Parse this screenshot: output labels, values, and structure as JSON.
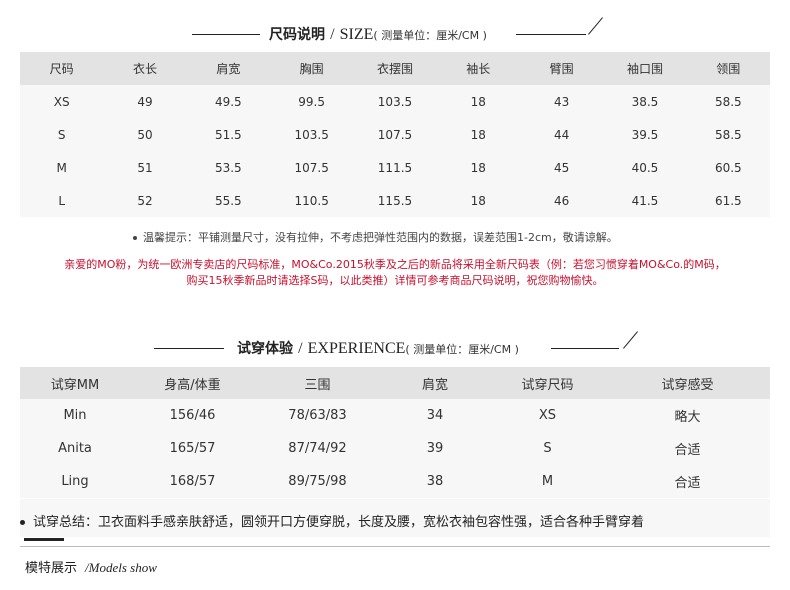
{
  "size": {
    "title_cn": "尺码说明",
    "title_sep": "/",
    "title_en": "SIZE",
    "unit": "( 测量单位：厘米/CM )",
    "headers": [
      "尺码",
      "衣长",
      "肩宽",
      "胸围",
      "衣摆围",
      "袖长",
      "臂围",
      "袖口围",
      "领围"
    ],
    "rows": [
      [
        "XS",
        "49",
        "49.5",
        "99.5",
        "103.5",
        "18",
        "43",
        "38.5",
        "58.5"
      ],
      [
        "S",
        "50",
        "51.5",
        "103.5",
        "107.5",
        "18",
        "44",
        "39.5",
        "58.5"
      ],
      [
        "M",
        "51",
        "53.5",
        "107.5",
        "111.5",
        "18",
        "45",
        "40.5",
        "60.5"
      ],
      [
        "L",
        "52",
        "55.5",
        "110.5",
        "115.5",
        "18",
        "46",
        "41.5",
        "61.5"
      ]
    ],
    "tip": "温馨提示：平铺测量尺寸，没有拉伸，不考虑把弹性范围内的数据，误差范围1-2cm，敬请谅解。",
    "notice_line1": "亲爱的MO粉，为统一欧洲专卖店的尺码标准，MO&Co.2015秋季及之后的新品将采用全新尺码表（例：若您习惯穿着MO&Co.的M码，",
    "notice_line2": "购买15秋季新品时请选择S码，以此类推）详情可参考商品尺码说明，祝您购物愉快。"
  },
  "experience": {
    "title_cn": "试穿体验",
    "title_sep": "/",
    "title_en": "EXPERIENCE",
    "unit": "( 测量单位：厘米/CM )",
    "headers": [
      "试穿MM",
      "身高/体重",
      "三围",
      "肩宽",
      "试穿尺码",
      "试穿感受"
    ],
    "rows": [
      [
        "Min",
        "156/46",
        "78/63/83",
        "34",
        "XS",
        "略大"
      ],
      [
        "Anita",
        "165/57",
        "87/74/92",
        "39",
        "S",
        "合适"
      ],
      [
        "Ling",
        "168/57",
        "89/75/98",
        "38",
        "M",
        "合适"
      ]
    ],
    "summary": "试穿总结：卫衣面料手感亲肤舒适，圆领开口方便穿脱，长度及腰，宽松衣袖包容性强，适合各种手臂穿着"
  },
  "models": {
    "title_cn": "模特展示",
    "title_en": "/Models show"
  }
}
